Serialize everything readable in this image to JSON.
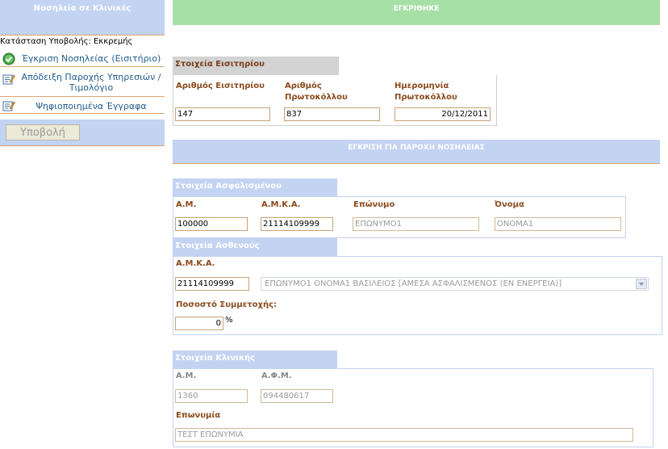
{
  "sidebar": {
    "title": "Νοσηλεία σε Κλινικές",
    "status_text": "Κατάσταση Υποβολής: Εκκρεμής",
    "items": [
      {
        "label": "Έγκριση Νοσηλείας (Εισιτήριο)",
        "icon": "check-circle-icon"
      },
      {
        "label": "Απόδειξη Παροχής Υπηρεσιών / Τιμολόγιο",
        "icon": "edit-document-icon"
      },
      {
        "label": "Ψηφιοποιημένα Έγγραφα",
        "icon": "edit-document-icon"
      }
    ],
    "submit_label": "Υποβολή"
  },
  "banners": {
    "approved": "ΕΓΚΡΙΘΗΚΕ",
    "approval_section": "ΕΓΚΡΙΣΗ ΓΙΑ ΠΑΡΟΧΗ ΝΟΣΗΛΕΙΑΣ"
  },
  "ticket": {
    "title": "Στοιχεία Εισιτηρίου",
    "ticket_no_label": "Αριθμός Εισιτηρίου",
    "ticket_no": "147",
    "protocol_no_label": "Αριθμός Πρωτοκόλλου",
    "protocol_no": "837",
    "protocol_date_label": "Ημερομηνία Πρωτοκόλλου",
    "protocol_date": "20/12/2011"
  },
  "insured": {
    "title": "Στοιχεία Ασφαλισμένου",
    "am_label": "Α.Μ.",
    "am": "100000",
    "amka_label": "Α.Μ.Κ.Α.",
    "amka": "21114109999",
    "surname_label": "Επώνυμο",
    "surname": "ΕΠΩΝΥΜΟ1",
    "name_label": "Όνομα",
    "name": "ΟΝΟΜΑ1"
  },
  "patient": {
    "title": "Στοιχεία Ασθενούς",
    "amka_label": "Α.Μ.Κ.Α.",
    "amka": "21114109999",
    "select_value": "ΕΠΩΝΥΜΟ1 ΟΝΟΜΑ1 ΒΑΣΙΛΕΙΟΣ [ΑΜΕΣΑ ΑΣΦΑΛΙΣΜΕΝΟΣ (ΕΝ ΕΝΕΡΓΕΙΑ)]",
    "participation_label": "Ποσοστό Συμμετοχής:",
    "participation": "0",
    "percent_sign": "%"
  },
  "clinic": {
    "title": "Στοιχεία Κλινικής",
    "am_label": "Α.Μ.",
    "am": "1360",
    "afm_label": "Α.Φ.Μ.",
    "afm": "094480617",
    "company_label": "Επωνυμία",
    "company": "ΤΕΣΤ ΕΠΩΝΥΜΙΑ"
  }
}
